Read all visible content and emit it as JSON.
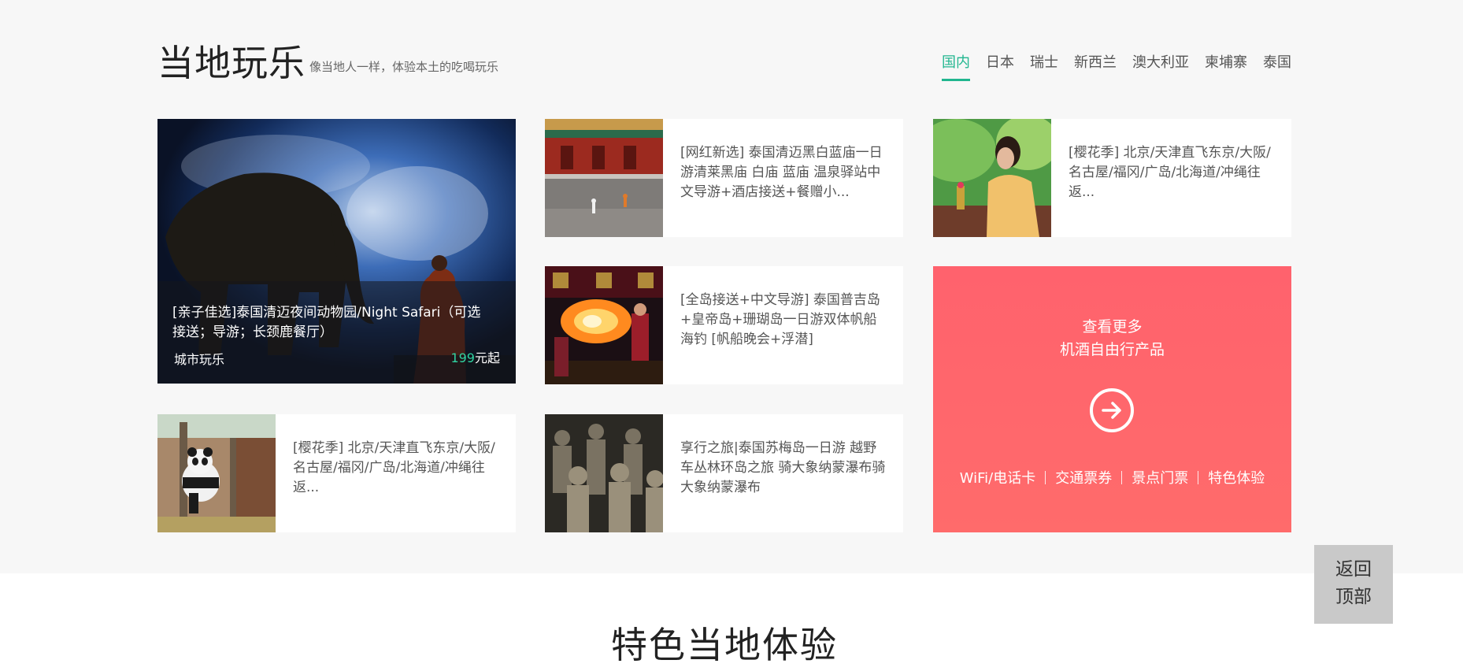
{
  "header": {
    "title": "当地玩乐",
    "subtitle": "像当地人一样，体验本土的吃喝玩乐"
  },
  "tabs": [
    {
      "label": "国内",
      "active": true
    },
    {
      "label": "日本",
      "active": false
    },
    {
      "label": "瑞士",
      "active": false
    },
    {
      "label": "新西兰",
      "active": false
    },
    {
      "label": "澳大利亚",
      "active": false
    },
    {
      "label": "柬埔寨",
      "active": false
    },
    {
      "label": "泰国",
      "active": false
    }
  ],
  "featured": {
    "title": "[亲子佳选]泰国清迈夜间动物园/Night Safari（可选接送；导游；长颈鹿餐厅）",
    "category": "城市玩乐",
    "price_num": "199",
    "price_unit": "元起"
  },
  "cards": [
    {
      "text": "[网红新选] 泰国清迈黑白蓝庙一日游清莱黑庙 白庙 蓝庙 温泉驿站中文导游+酒店接送+餐赠小..."
    },
    {
      "text": "[樱花季] 北京/天津直飞东京/大阪/名古屋/福冈/广岛/北海道/冲绳往返..."
    },
    {
      "text": "[全岛接送+中文导游] 泰国普吉岛+皇帝岛+珊瑚岛一日游双体帆船海钓 [帆船晚会+浮潜]"
    },
    {
      "text": "[樱花季] 北京/天津直飞东京/大阪/名古屋/福冈/广岛/北海道/冲绳往返..."
    },
    {
      "text": "享行之旅|泰国苏梅岛一日游 越野车丛林环岛之旅 骑大象纳蒙瀑布骑大象纳蒙瀑布"
    }
  ],
  "promo": {
    "line1": "查看更多",
    "line2": "机酒自由行产品",
    "links": [
      "WiFi/电话卡",
      "交通票券",
      "景点门票",
      "特色体验"
    ]
  },
  "back_top": {
    "line1": "返回",
    "line2": "顶部"
  },
  "section2": {
    "title": "特色当地体验"
  },
  "colors": {
    "accent": "#21b68f",
    "promo": "#ff646d",
    "price": "#2fd3a2"
  }
}
